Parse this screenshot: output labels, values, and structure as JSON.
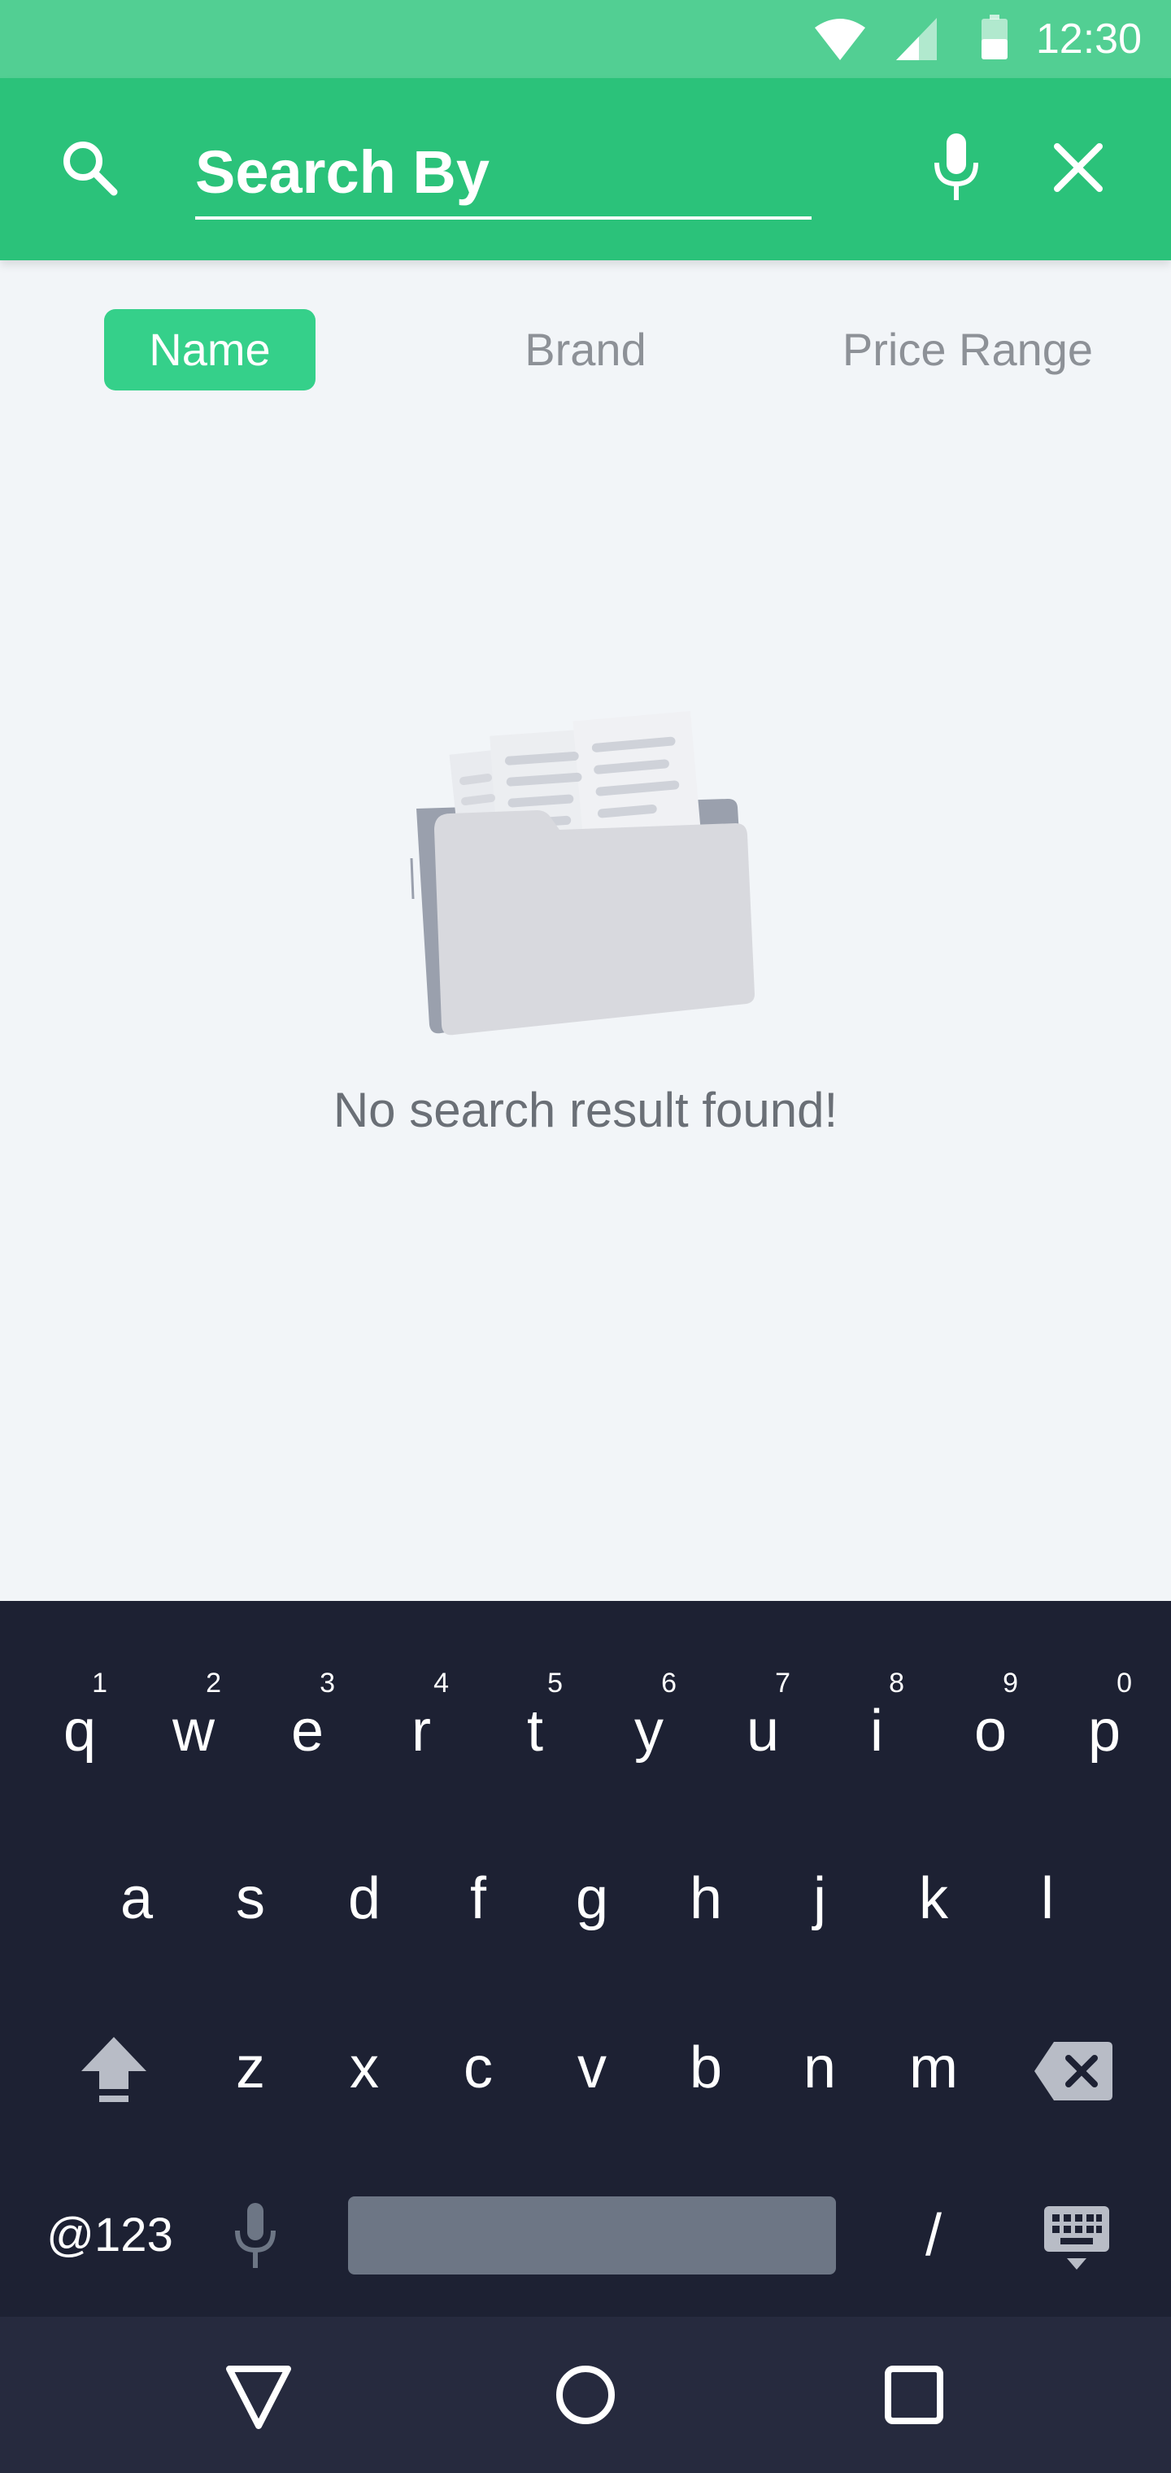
{
  "status_bar": {
    "time": "12:30",
    "icons": [
      "wifi-icon",
      "cellular-signal-icon",
      "battery-icon"
    ]
  },
  "search": {
    "placeholder": "Search By",
    "value": "",
    "icons": [
      "search-icon",
      "microphone-icon",
      "close-icon"
    ]
  },
  "tabs": [
    {
      "label": "Name",
      "active": true
    },
    {
      "label": "Brand",
      "active": false
    },
    {
      "label": "Price Range",
      "active": false
    }
  ],
  "empty_state": {
    "message": "No search result found!",
    "icon": "empty-folder-illustration"
  },
  "keyboard": {
    "row1": [
      {
        "key": "q",
        "hint": "1"
      },
      {
        "key": "w",
        "hint": "2"
      },
      {
        "key": "e",
        "hint": "3"
      },
      {
        "key": "r",
        "hint": "4"
      },
      {
        "key": "t",
        "hint": "5"
      },
      {
        "key": "y",
        "hint": "6"
      },
      {
        "key": "u",
        "hint": "7"
      },
      {
        "key": "i",
        "hint": "8"
      },
      {
        "key": "o",
        "hint": "9"
      },
      {
        "key": "p",
        "hint": "0"
      }
    ],
    "row2": [
      "a",
      "s",
      "d",
      "f",
      "g",
      "h",
      "j",
      "k",
      "l"
    ],
    "row3": [
      "z",
      "x",
      "c",
      "v",
      "b",
      "n",
      "m"
    ],
    "symbols_key": "@123",
    "slash_key": "/",
    "icons": [
      "shift-icon",
      "backspace-icon",
      "voice-input-icon",
      "keyboard-hide-icon"
    ]
  },
  "nav_bar": {
    "icons": [
      "back-icon",
      "home-icon",
      "recents-icon"
    ]
  },
  "colors": {
    "status_bar": "#52cf93",
    "app_bar": "#2bc27a",
    "active_tab": "#35d08a",
    "keyboard_bg": "#1d2133",
    "nav_bg": "#262a3e"
  }
}
